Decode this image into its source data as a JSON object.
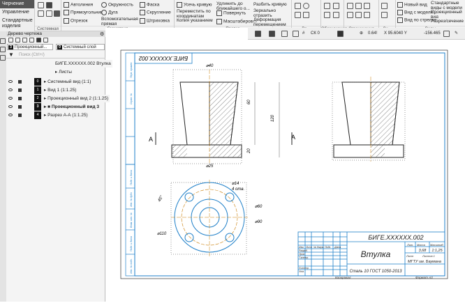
{
  "ribbon": {
    "tabs": [
      "Черчение",
      "Управление",
      "Стандартные изделия"
    ],
    "groups": {
      "system": "Системная",
      "geometry": "Геометрия",
      "edit": "Правка",
      "marks": "Обозначения",
      "constraints": "Ограничения",
      "dims": "Ди...",
      "views": "Виды",
      "params": "Ра..."
    },
    "geometry": [
      "Автолиния",
      "Прямоугольник",
      "Отрезок",
      "Окружность",
      "Дуга",
      "Вспомогательная прямая",
      "Фаска",
      "Скругление",
      "Штриховка"
    ],
    "edit": [
      "Усечь кривую",
      "Переместить по координатам",
      "Копия указанием",
      "Удлинить до ближайшего о...",
      "Повернуть",
      "Масштабиров...",
      "Разбить кривую",
      "Зеркально отразить",
      "Деформация перемещением"
    ],
    "views": [
      "Новый вид",
      "Вид с модели...",
      "Вид по стрелке",
      "Стандартные виды с модели",
      "Проекционный вид",
      "Разрез/сечение"
    ]
  },
  "tree": {
    "title": "Дерево чертежа",
    "view_select": {
      "num": "3",
      "label": "Проекционный..."
    },
    "layer_select": {
      "num": "0",
      "label": "Системный слой"
    },
    "search_placeholder": "Поиск (Ctrl+/)",
    "root": "БИГЕ.XXXXXX.002 Втулка",
    "sheets": "Листы",
    "items": [
      {
        "num": "0",
        "label": "Системный вид (1:1)"
      },
      {
        "num": "1",
        "label": "Вид 1 (1:1.25)"
      },
      {
        "num": "2",
        "label": "Проекционный вид 2 (1:1.25)"
      },
      {
        "num": "3",
        "label": "Проекционный вид 3"
      },
      {
        "num": "4",
        "label": "Разрез А-А (1:1.25)"
      }
    ]
  },
  "statusbar": {
    "layer": "СК 0",
    "zoom": "0.64!",
    "x": "X 95.6040 Y",
    "y": "-156.465"
  },
  "drawing": {
    "stamp_mirror": "БИГЕ.XXXXXX.002",
    "dims": [
      "⌀40",
      "60",
      "120",
      "20",
      "⌀25",
      "⌀14",
      "4 отв.",
      "⌀60",
      "⌀90",
      "⌀110",
      "45°"
    ],
    "section": "А",
    "title_block": {
      "designation": "БИГЕ.XXXXXX.002",
      "name": "Втулка",
      "material": "Сталь 10  ГОСТ 1050-2013",
      "mass": "3,68",
      "scale": "1:1,25",
      "org": "МГТУ им. Баумана",
      "sheet": "Лист",
      "sheets": "Листов  1",
      "lit": "Лит.",
      "mass_h": "Масса",
      "scale_h": "Масштаб",
      "copied": "Копировал",
      "format": "Формат   А3",
      "rows": [
        "Изм.",
        "Лист",
        "№ докум.",
        "Подп.",
        "Дата",
        "Разраб.",
        "Пров.",
        "Т.контр.",
        "Н.контр.",
        "Утв."
      ]
    },
    "side_labels": [
      "Перв. примен.",
      "Справ. №",
      "Подп. и дата",
      "Инв. № дубл.",
      "Взам. инв. №",
      "Подп. и дата",
      "Инв. № подл."
    ]
  },
  "colors": {
    "accent": "#1e7fc8",
    "hatch": "#333333",
    "axis": "#c87a00"
  }
}
